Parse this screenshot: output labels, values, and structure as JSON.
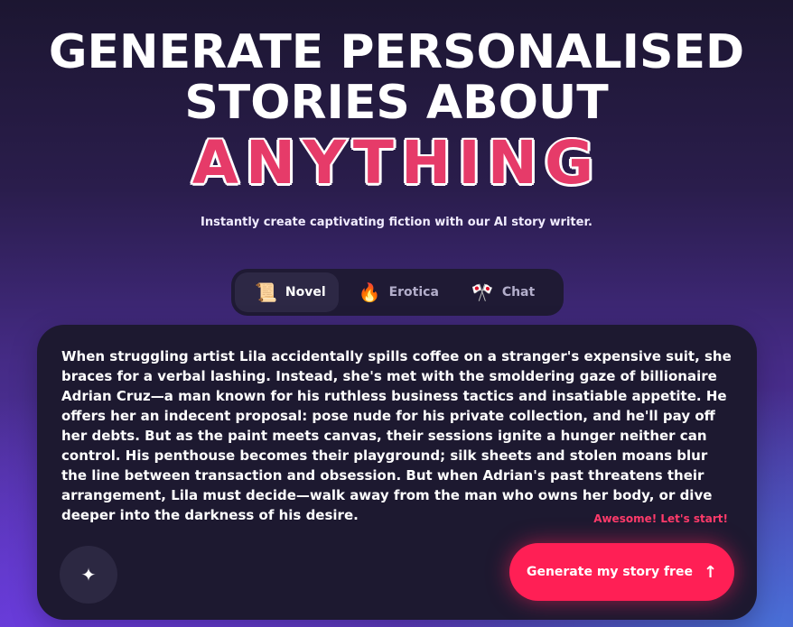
{
  "hero": {
    "line1": "GENERATE PERSONALISED",
    "line2": "STORIES ABOUT",
    "accent": "ANYTHING",
    "subtitle": "Instantly create captivating fiction with our AI story writer."
  },
  "tabs": [
    {
      "label": "Novel",
      "icon": "book-icon",
      "glyph": "📜",
      "active": true
    },
    {
      "label": "Erotica",
      "icon": "fire-icon",
      "glyph": "🔥",
      "active": false
    },
    {
      "label": "Chat",
      "icon": "flag-chat-icon",
      "glyph": "🎌",
      "active": false
    }
  ],
  "card": {
    "story": "When struggling artist Lila accidentally spills coffee on a stranger's expensive suit, she braces for a verbal lashing. Instead, she's met with the smoldering gaze of billionaire Adrian Cruz—a man known for his ruthless business tactics and insatiable appetite. He offers her an indecent proposal: pose nude for his private collection, and he'll pay off her debts. But as the paint meets canvas, their sessions ignite a hunger neither can control. His penthouse becomes their playground; silk sheets and stolen moans blur the line between transaction and obsession. But when Adrian's past threatens their arrangement, Lila must decide—walk away from the man who owns her body, or dive deeper into the darkness of his desire.",
    "awesome": "Awesome! Let's start!",
    "sparkle_icon": "sparkle-icon",
    "generate_label": "Generate my story free",
    "generate_icon": "arrow-up-icon"
  },
  "colors": {
    "accent": "#ff1f55",
    "accent_text": "#e63b69",
    "card_bg": "#1d1930"
  }
}
